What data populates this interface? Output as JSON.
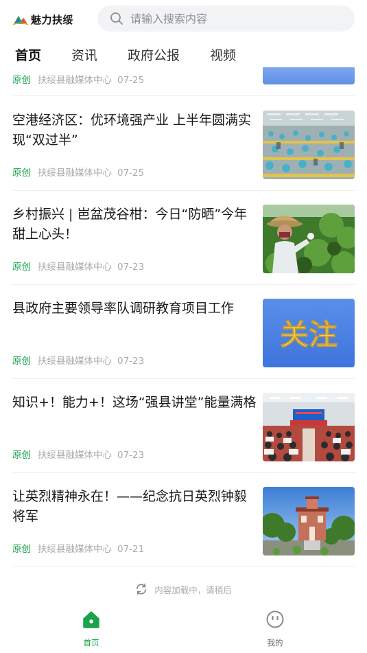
{
  "app": {
    "title": "魅力扶绥"
  },
  "search": {
    "placeholder": "请输入搜索内容"
  },
  "tabs": [
    {
      "label": "首页",
      "active": true
    },
    {
      "label": "资讯",
      "active": false
    },
    {
      "label": "政府公报",
      "active": false
    },
    {
      "label": "视频",
      "active": false
    }
  ],
  "partial_item": {
    "tag": "原创",
    "source": "扶绥县融媒体中心",
    "date": "07-25"
  },
  "articles": [
    {
      "title": "空港经济区：优环境强产业 上半年圆满实现“双过半”",
      "tag": "原创",
      "source": "扶绥县融媒体中心",
      "date": "07-25",
      "image": "factory-photo"
    },
    {
      "title": "乡村振兴 | 岜盆茂谷柑：今日“防晒”今年甜上心头！",
      "tag": "原创",
      "source": "扶绥县融媒体中心",
      "date": "07-23",
      "image": "orchard-photo"
    },
    {
      "title": "县政府主要领导率队调研教育项目工作",
      "tag": "原创",
      "source": "扶绥县融媒体中心",
      "date": "07-23",
      "image": "focus-banner",
      "image_text": "关注"
    },
    {
      "title": "知识+！能力+！这场“强县讲堂”能量满格",
      "tag": "原创",
      "source": "扶绥县融媒体中心",
      "date": "07-23",
      "image": "lecture-hall-photo"
    },
    {
      "title": "让英烈精神永在！——纪念抗日英烈钟毅将军",
      "tag": "原创",
      "source": "扶绥县融媒体中心",
      "date": "07-21",
      "image": "memorial-building-photo"
    }
  ],
  "loading": {
    "text": "内容加载中，请稍后"
  },
  "bottom_nav": [
    {
      "label": "首页",
      "icon": "home-icon",
      "active": true
    },
    {
      "label": "我的",
      "icon": "profile-icon",
      "active": false
    }
  ],
  "colors": {
    "accent": "#1aa34a",
    "focus_banner": "#4a7fe0",
    "focus_text": "#f5d96b"
  }
}
